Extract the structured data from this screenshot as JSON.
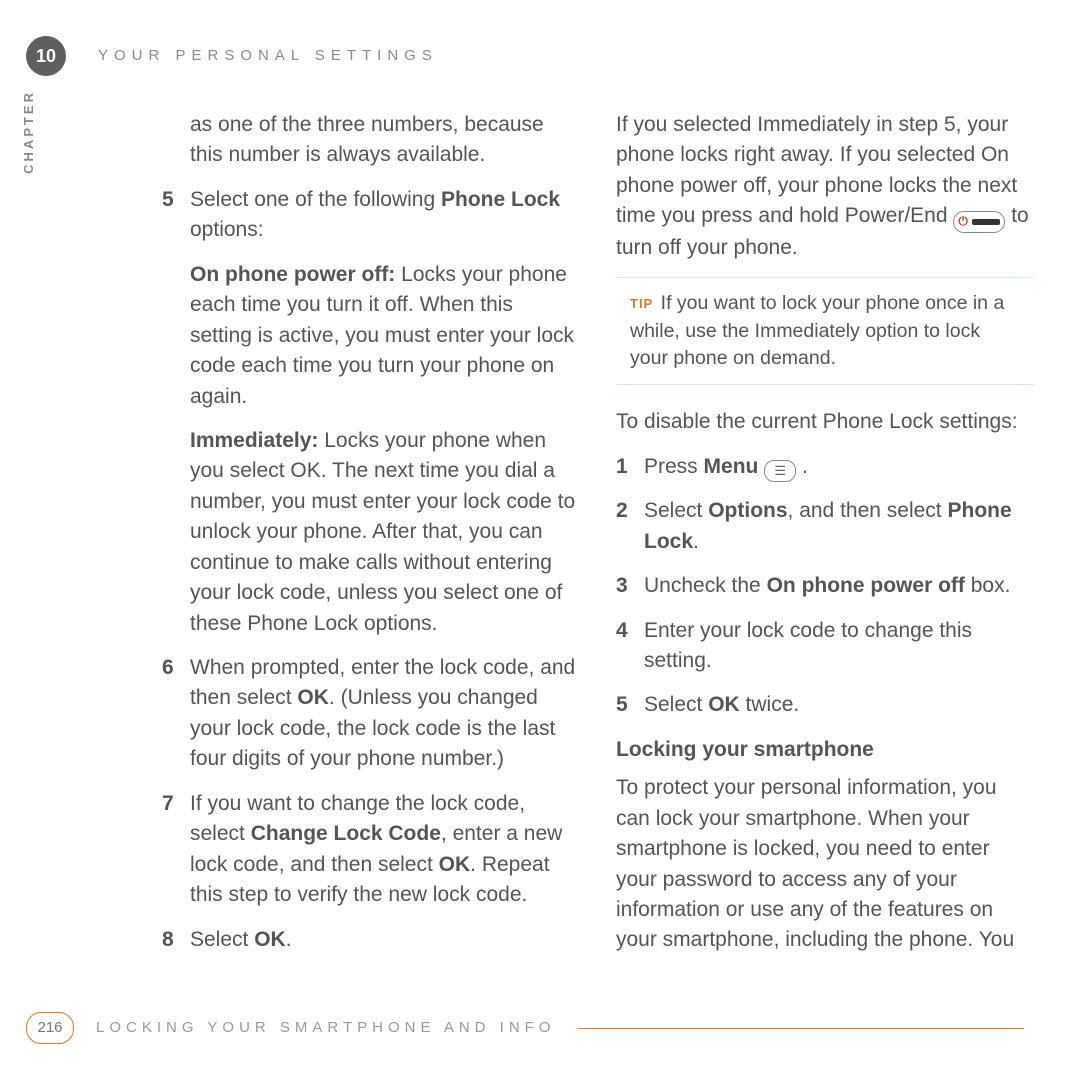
{
  "chapter": {
    "number": "10",
    "title": "YOUR PERSONAL SETTINGS",
    "side_label": "CHAPTER"
  },
  "icons": {
    "menu": "☰",
    "power_glyph": "⏻"
  },
  "left": {
    "intro": "as one of the three numbers, because this number is always available.",
    "s5": {
      "num": "5",
      "lead": "Select one of the following ",
      "bold": "Phone Lock",
      "tail": " options:"
    },
    "opt1": {
      "bold": "On phone power off:",
      "text": " Locks your phone each time you turn it off. When this setting is active, you must enter your lock code each time you turn your phone on again."
    },
    "opt2": {
      "bold": "Immediately:",
      "text": " Locks your phone when you select OK. The next time you dial a number, you must enter your lock code to unlock your phone. After that, you can continue to make calls without entering your lock code, unless you select one of these Phone Lock options."
    },
    "s6": {
      "num": "6",
      "a": "When prompted, enter the lock code, and then select ",
      "b1": "OK",
      "b": ". (Unless you changed your lock code, the lock code is the last four digits of your phone number.)"
    },
    "s7": {
      "num": "7",
      "a": "If you want to change the lock code, select ",
      "b1": "Change Lock Code",
      "b": ", enter a new lock code, and then select ",
      "b2": "OK",
      "c": ". Repeat this step to verify the new lock code."
    },
    "s8": {
      "num": "8",
      "a": "Select ",
      "b1": "OK",
      "b": "."
    }
  },
  "right": {
    "p1a": "If you selected Immediately in step 5, your phone locks right away. If you selected On phone power off, your phone locks the next time you press and hold Power/End ",
    "p1b": " to turn off your phone.",
    "tip": {
      "label": "TIP",
      "text": "If you want to lock your phone once in a while, use the Immediately option to lock your phone on demand."
    },
    "disable_lead": "To  disable the current Phone Lock settings:",
    "d1": {
      "num": "1",
      "a": "Press ",
      "b1": "Menu",
      "b": " ."
    },
    "d2": {
      "num": "2",
      "a": "Select ",
      "b1": "Options",
      "b": ", and then select ",
      "b2": "Phone Lock",
      "c": "."
    },
    "d3": {
      "num": "3",
      "a": "Uncheck the ",
      "b1": "On phone power off",
      "b": " box."
    },
    "d4": {
      "num": "4",
      "a": "Enter your lock code to change this setting."
    },
    "d5": {
      "num": "5",
      "a": "Select ",
      "b1": "OK",
      "b": " twice."
    },
    "h": "Locking your smartphone",
    "p2": "To protect your personal information, you can lock your smartphone. When your smartphone is locked, you need to enter your password to access any of your information or use any of the features on your smartphone, including the phone. You"
  },
  "footer": {
    "page": "216",
    "title": "LOCKING YOUR SMARTPHONE AND INFO"
  }
}
